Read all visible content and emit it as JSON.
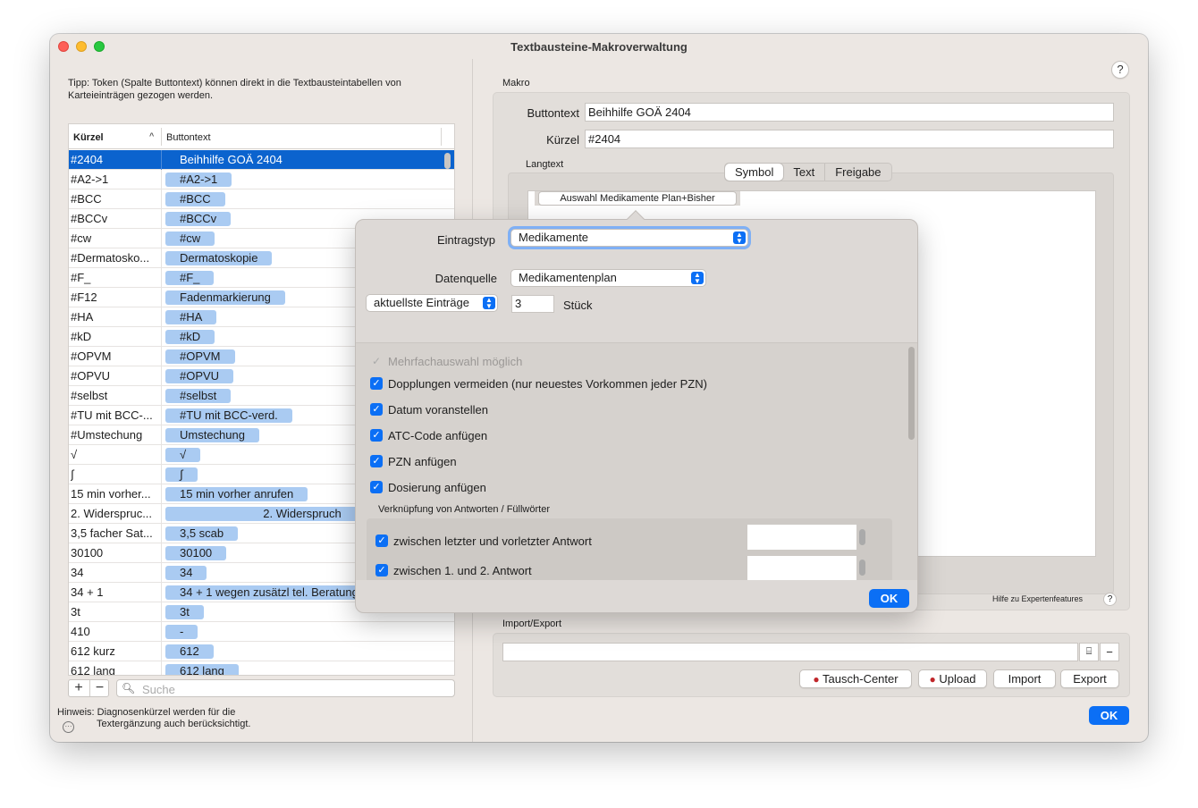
{
  "window": {
    "title": "Textbausteine-Makroverwaltung"
  },
  "tip": "Tipp: Token (Spalte Buttontext) können direkt in die Textbausteintabellen von Karteieinträgen gezogen werden.",
  "table": {
    "col1": "Kürzel",
    "col2": "Buttontext",
    "rows": [
      {
        "k": "#2404",
        "b": "Beihhilfe GOÄ 2404"
      },
      {
        "k": "#A2->1",
        "b": "#A2->1"
      },
      {
        "k": "#BCC",
        "b": "#BCC"
      },
      {
        "k": "#BCCv",
        "b": "#BCCv"
      },
      {
        "k": "#cw",
        "b": "#cw"
      },
      {
        "k": "#Dermatosko...",
        "b": "Dermatoskopie"
      },
      {
        "k": "#F_",
        "b": "#F_"
      },
      {
        "k": "#F12",
        "b": "Fadenmarkierung"
      },
      {
        "k": "#HA",
        "b": "#HA"
      },
      {
        "k": "#kD",
        "b": "#kD"
      },
      {
        "k": "#OPVM",
        "b": "#OPVM"
      },
      {
        "k": "#OPVU",
        "b": "#OPVU"
      },
      {
        "k": "#selbst",
        "b": "#selbst"
      },
      {
        "k": "#TU mit BCC-...",
        "b": "#TU mit BCC-verd."
      },
      {
        "k": "#Umstechung",
        "b": "Umstechung"
      },
      {
        "k": "√",
        "b": "√"
      },
      {
        "k": "∫",
        "b": "∫"
      },
      {
        "k": "15 min vorher...",
        "b": "15 min vorher anrufen"
      },
      {
        "k": "2. Widerspruc...",
        "b": "2. Widerspruch"
      },
      {
        "k": "3,5 facher Sat...",
        "b": "3,5 scab"
      },
      {
        "k": "30100",
        "b": "30100"
      },
      {
        "k": "34",
        "b": "34"
      },
      {
        "k": "34 + 1",
        "b": "34 + 1 wegen zusätzl tel. Beratung"
      },
      {
        "k": "3t",
        "b": "3t"
      },
      {
        "k": "410",
        "b": "-"
      },
      {
        "k": "612 kurz",
        "b": "612"
      },
      {
        "k": "612 lang",
        "b": "612 lang"
      }
    ]
  },
  "search": {
    "placeholder": "Suche"
  },
  "hint": {
    "line1": "Hinweis: Diagnosenkürzel werden für die",
    "line2": "Textergänzung auch berücksichtigt."
  },
  "makro": {
    "section": "Makro",
    "buttontext_label": "Buttontext",
    "buttontext_value": "Beihhilfe GOÄ 2404",
    "kuerzel_label": "Kürzel",
    "kuerzel_value": "#2404",
    "langtext_label": "Langtext",
    "tabs": [
      "Symbol",
      "Text",
      "Freigabe"
    ],
    "chip": "Auswahl Medikamente Plan+Bisher",
    "hilfe": "Hilfe zu Expertenfeatures"
  },
  "importexport": {
    "section": "Import/Export",
    "tausch": "Tausch-Center",
    "upload": "Upload",
    "import": "Import",
    "export": "Export"
  },
  "ok": "OK",
  "popup": {
    "eintragstyp_label": "Eintragstyp",
    "eintragstyp_value": "Medikamente",
    "datenquelle_label": "Datenquelle",
    "datenquelle_value": "Medikamentenplan",
    "aktuell": "aktuellste Einträge",
    "count": "3",
    "stueck": "Stück",
    "mehrfach": "Mehrfachauswahl möglich",
    "dopplungen": "Dopplungen vermeiden (nur neuestes Vorkommen jeder PZN)",
    "datum": "Datum voranstellen",
    "atc": "ATC-Code anfügen",
    "pzn": "PZN anfügen",
    "dosierung": "Dosierung anfügen",
    "verknuepfung": "Verknüpfung von Antworten / Füllwörter",
    "vk1": "zwischen letzter und vorletzter  Antwort",
    "vk2": "zwischen 1. und 2. Antwort",
    "ok": "OK"
  }
}
